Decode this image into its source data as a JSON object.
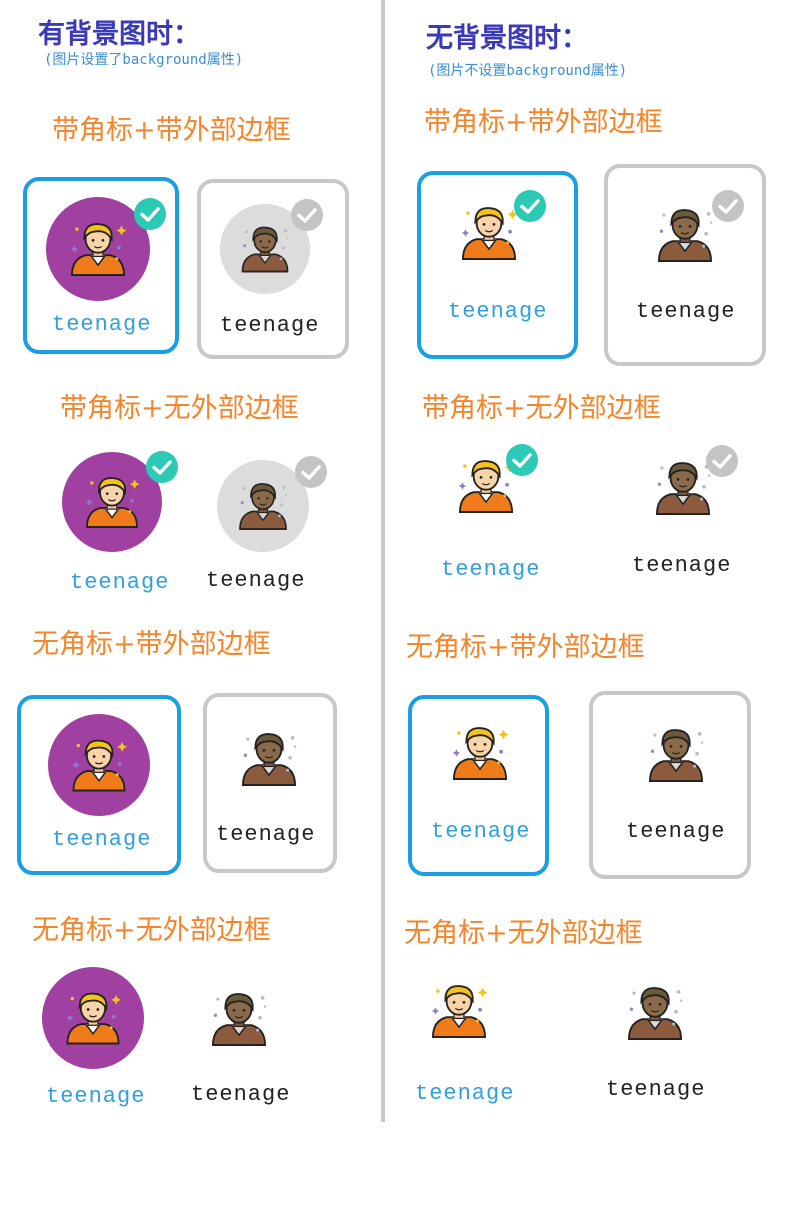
{
  "left": {
    "title": "有背景图时：",
    "subtitle": "(图片设置了background属性)"
  },
  "right": {
    "title": "无背景图时：",
    "subtitle": "(图片不设置background属性)"
  },
  "sections": {
    "badge_border": "带角标+带外部边框",
    "badge_noborder": "带角标+无外部边框",
    "nobadge_border": "无角标+带外部边框",
    "nobadge_noborder": "无角标+无外部边框"
  },
  "item_label": "teenage",
  "colors": {
    "accent": "#1a9fe4",
    "check": "#2cc9b4",
    "unselected": "#c8c8c8",
    "purple_bg": "#a040a0",
    "gray_bg": "#dcdcdc",
    "section_text": "#f5852a"
  },
  "icons": {
    "avatar": "teenager-avatar-icon",
    "check": "checkmark-circle-icon"
  }
}
